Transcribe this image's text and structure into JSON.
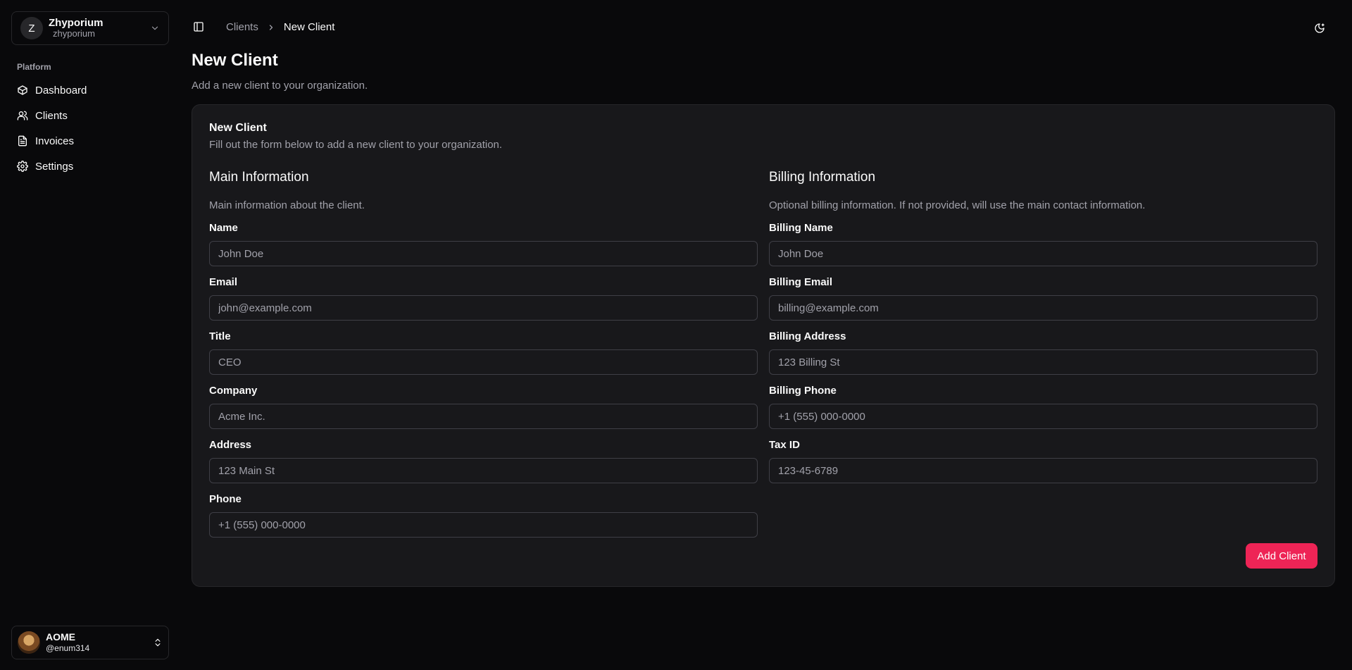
{
  "colors": {
    "background": "#09090b",
    "card": "#18181b",
    "border": "#27272a",
    "muted_text": "#a1a1aa",
    "accent": "#ee2456"
  },
  "org": {
    "initial": "Z",
    "name": "Zhyporium",
    "slug": "zhyporium"
  },
  "sidebar": {
    "group_label": "Platform",
    "items": [
      {
        "label": "Dashboard",
        "icon": "box-icon"
      },
      {
        "label": "Clients",
        "icon": "users-icon"
      },
      {
        "label": "Invoices",
        "icon": "file-text-icon"
      },
      {
        "label": "Settings",
        "icon": "gear-icon"
      }
    ]
  },
  "user": {
    "name": "AOME",
    "handle": "@enum314"
  },
  "breadcrumb": {
    "parent": "Clients",
    "current": "New Client"
  },
  "page": {
    "title": "New Client",
    "subtitle": "Add a new client to your organization."
  },
  "card": {
    "title": "New Client",
    "description": "Fill out the form below to add a new client to your organization."
  },
  "main_info": {
    "title": "Main Information",
    "description": "Main information about the client.",
    "fields": [
      {
        "label": "Name",
        "placeholder": "John Doe"
      },
      {
        "label": "Email",
        "placeholder": "john@example.com"
      },
      {
        "label": "Title",
        "placeholder": "CEO"
      },
      {
        "label": "Company",
        "placeholder": "Acme Inc."
      },
      {
        "label": "Address",
        "placeholder": "123 Main St"
      },
      {
        "label": "Phone",
        "placeholder": "+1 (555) 000-0000"
      }
    ]
  },
  "billing_info": {
    "title": "Billing Information",
    "description": "Optional billing information. If not provided, will use the main contact information.",
    "fields": [
      {
        "label": "Billing Name",
        "placeholder": "John Doe"
      },
      {
        "label": "Billing Email",
        "placeholder": "billing@example.com"
      },
      {
        "label": "Billing Address",
        "placeholder": "123 Billing St"
      },
      {
        "label": "Billing Phone",
        "placeholder": "+1 (555) 000-0000"
      },
      {
        "label": "Tax ID",
        "placeholder": "123-45-6789"
      }
    ]
  },
  "actions": {
    "submit_label": "Add Client"
  }
}
